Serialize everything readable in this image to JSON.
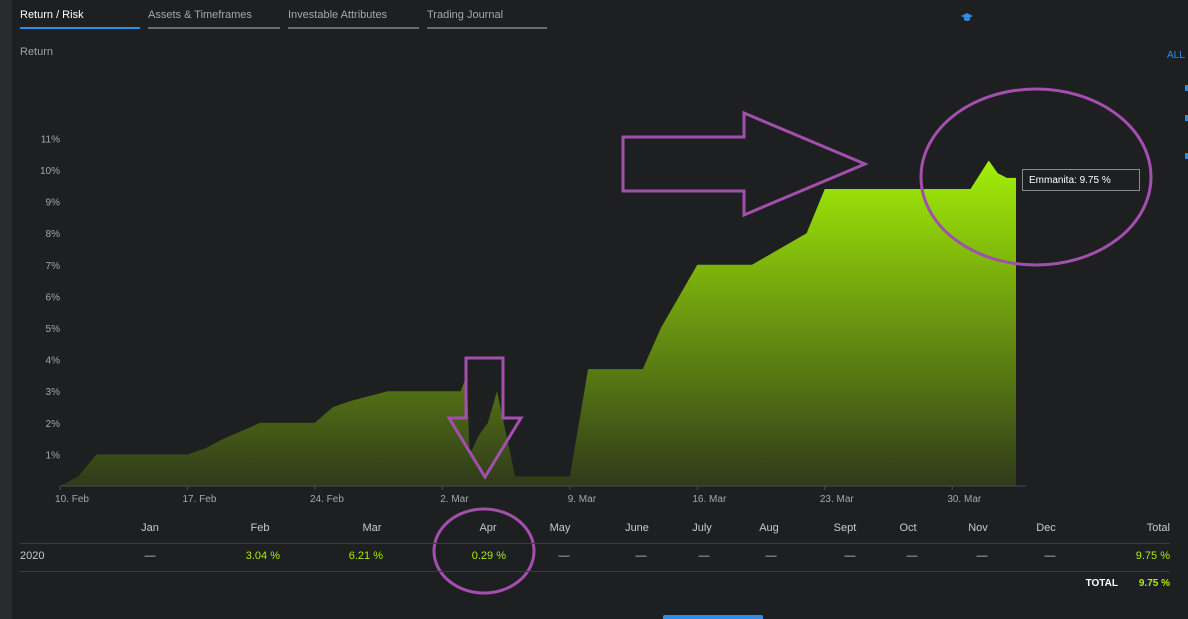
{
  "tabs": [
    {
      "label": "Return / Risk",
      "active": true
    },
    {
      "label": "Assets & Timeframes",
      "active": false
    },
    {
      "label": "Investable Attributes",
      "active": false
    },
    {
      "label": "Trading Journal",
      "active": false
    }
  ],
  "icons": {
    "cap": "graduation-cap-icon"
  },
  "section_label": "Return",
  "range_link": "ALL",
  "tooltip": "Emmanita: 9.75 %",
  "colors": {
    "background": "#1e1f20",
    "accent": "#2e8ee6",
    "positive": "#a9ee12",
    "area_top": "#a3ef06",
    "area_bottom": "#2f3a1a",
    "annotation": "#a24fae"
  },
  "chart_data": {
    "type": "area",
    "title": "",
    "xlabel": "",
    "ylabel": "Return",
    "x_ticks": [
      "10. Feb",
      "17. Feb",
      "24. Feb",
      "2. Mar",
      "9. Mar",
      "16. Mar",
      "23. Mar",
      "30. Mar"
    ],
    "y_ticks": [
      "1%",
      "2%",
      "3%",
      "4%",
      "5%",
      "6%",
      "7%",
      "8%",
      "9%",
      "10%",
      "11%"
    ],
    "ylim": [
      0,
      11.5
    ],
    "grid": false,
    "series": [
      {
        "name": "Emmanita",
        "x": [
          "2020-02-10",
          "2020-02-11",
          "2020-02-12",
          "2020-02-14",
          "2020-02-17",
          "2020-02-18",
          "2020-02-19",
          "2020-02-21",
          "2020-02-24",
          "2020-02-25",
          "2020-02-26",
          "2020-02-28",
          "2020-03-03",
          "2020-03-03T08",
          "2020-03-03T12",
          "2020-03-04",
          "2020-03-04T12",
          "2020-03-05",
          "2020-03-06",
          "2020-03-08",
          "2020-03-08T12",
          "2020-03-09",
          "2020-03-10",
          "2020-03-12",
          "2020-03-13",
          "2020-03-14",
          "2020-03-16",
          "2020-03-17",
          "2020-03-19",
          "2020-03-22",
          "2020-03-23",
          "2020-03-24",
          "2020-03-25",
          "2020-03-26",
          "2020-03-31",
          "2020-04-01",
          "2020-04-01T12",
          "2020-04-02",
          "2020-04-02T12"
        ],
        "values": [
          0,
          0.3,
          1.0,
          1.0,
          1.0,
          1.2,
          1.5,
          2.0,
          2.0,
          2.5,
          2.7,
          3.0,
          3.0,
          3.5,
          1.0,
          1.6,
          2.0,
          3.0,
          0.3,
          0.3,
          0.3,
          0.3,
          3.7,
          3.7,
          3.7,
          5.0,
          7.0,
          7.0,
          7.0,
          8.0,
          9.4,
          9.4,
          9.4,
          9.4,
          9.4,
          10.3,
          9.9,
          9.75,
          9.75
        ]
      }
    ],
    "annotations": [
      "Emmanita: 9.75 %"
    ]
  },
  "table": {
    "headers": [
      "",
      "Jan",
      "Feb",
      "Mar",
      "Apr",
      "May",
      "June",
      "July",
      "Aug",
      "Sept",
      "Oct",
      "Nov",
      "Dec",
      "Total"
    ],
    "rows": [
      {
        "year": "2020",
        "values": [
          "—",
          "3.04 %",
          "6.21 %",
          "0.29 %",
          "—",
          "—",
          "—",
          "—",
          "—",
          "—",
          "—",
          "—"
        ],
        "total": "9.75 %"
      }
    ],
    "total_label": "TOTAL",
    "total_value": "9.75 %"
  }
}
